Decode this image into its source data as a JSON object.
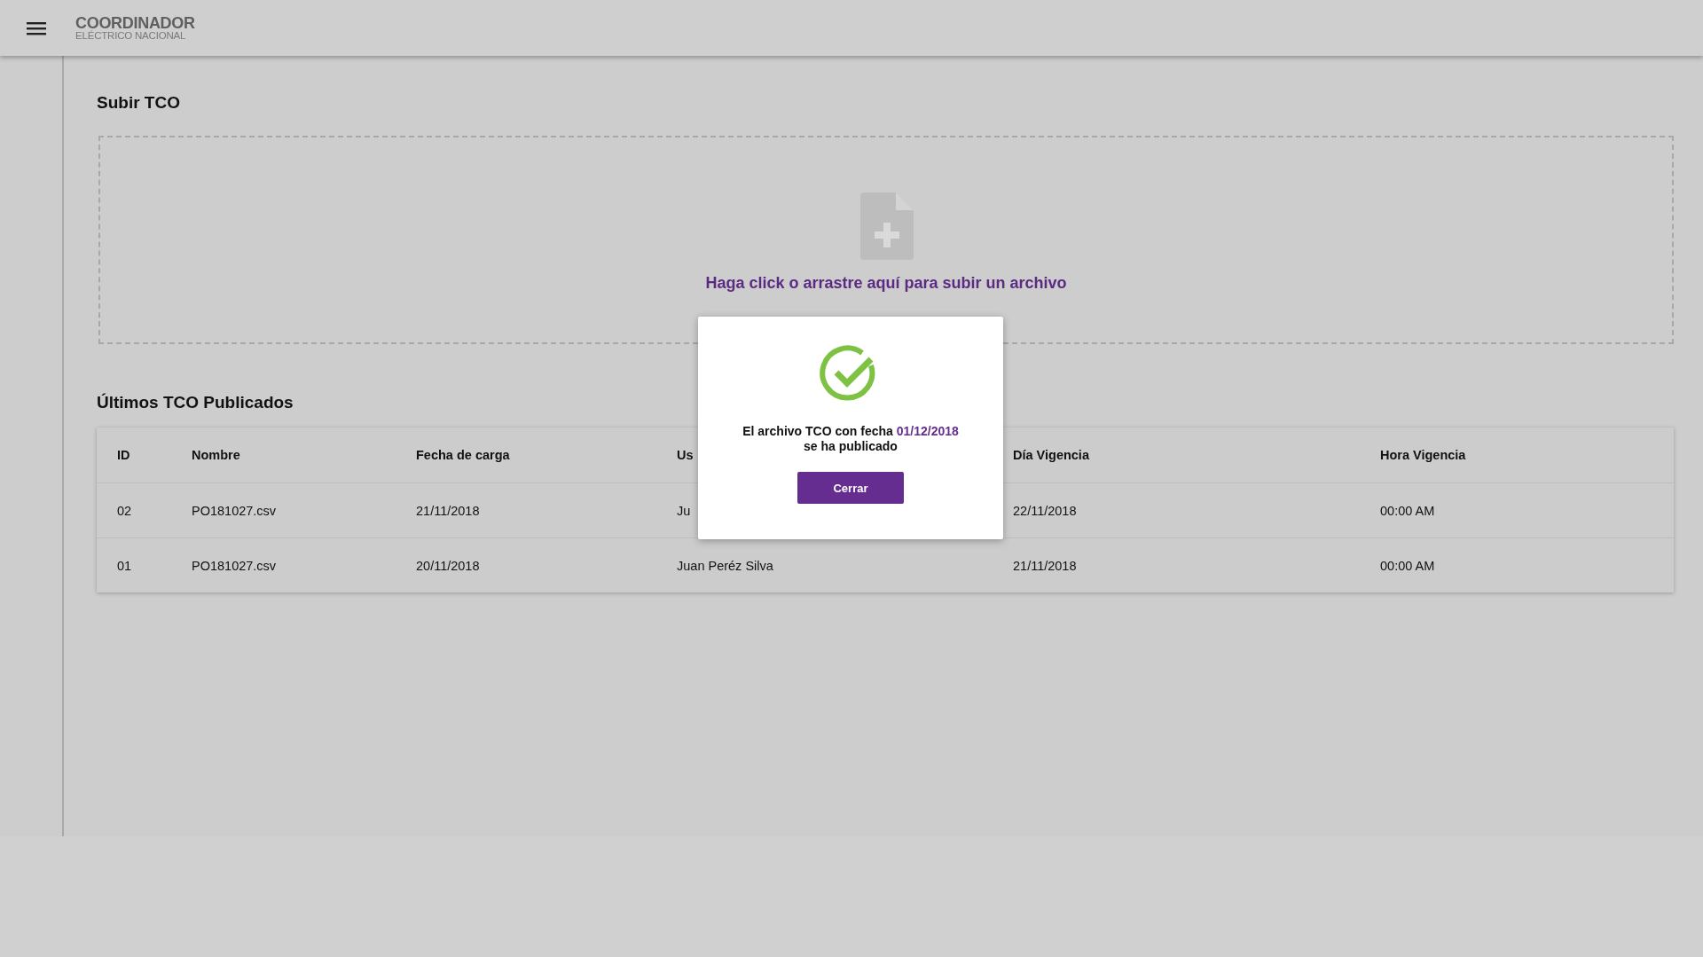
{
  "header": {
    "logo_title": "COORDINADOR",
    "logo_subtitle": "ELÉCTRICO NACIONAL"
  },
  "upload": {
    "title": "Subir TCO",
    "dropzone_text": "Haga click o arrastre aquí para subir un archivo"
  },
  "table": {
    "title": "Últimos TCO Publicados",
    "columns": [
      "ID",
      "Nombre",
      "Fecha de carga",
      "Us",
      "Día Vigencia",
      "Hora Vigencia"
    ],
    "rows": [
      [
        "02",
        "PO181027.csv",
        "21/11/2018",
        "Ju",
        "22/11/2018",
        "00:00 AM"
      ],
      [
        "01",
        "PO181027.csv",
        "20/11/2018",
        "Juan Peréz Silva",
        "21/11/2018",
        "00:00 AM"
      ]
    ]
  },
  "dialog": {
    "message_lead": "El archivo TCO con fecha ",
    "highlighted_date": "01/12/2018",
    "message_end": "se ha publicado",
    "button": "Cerrar"
  }
}
